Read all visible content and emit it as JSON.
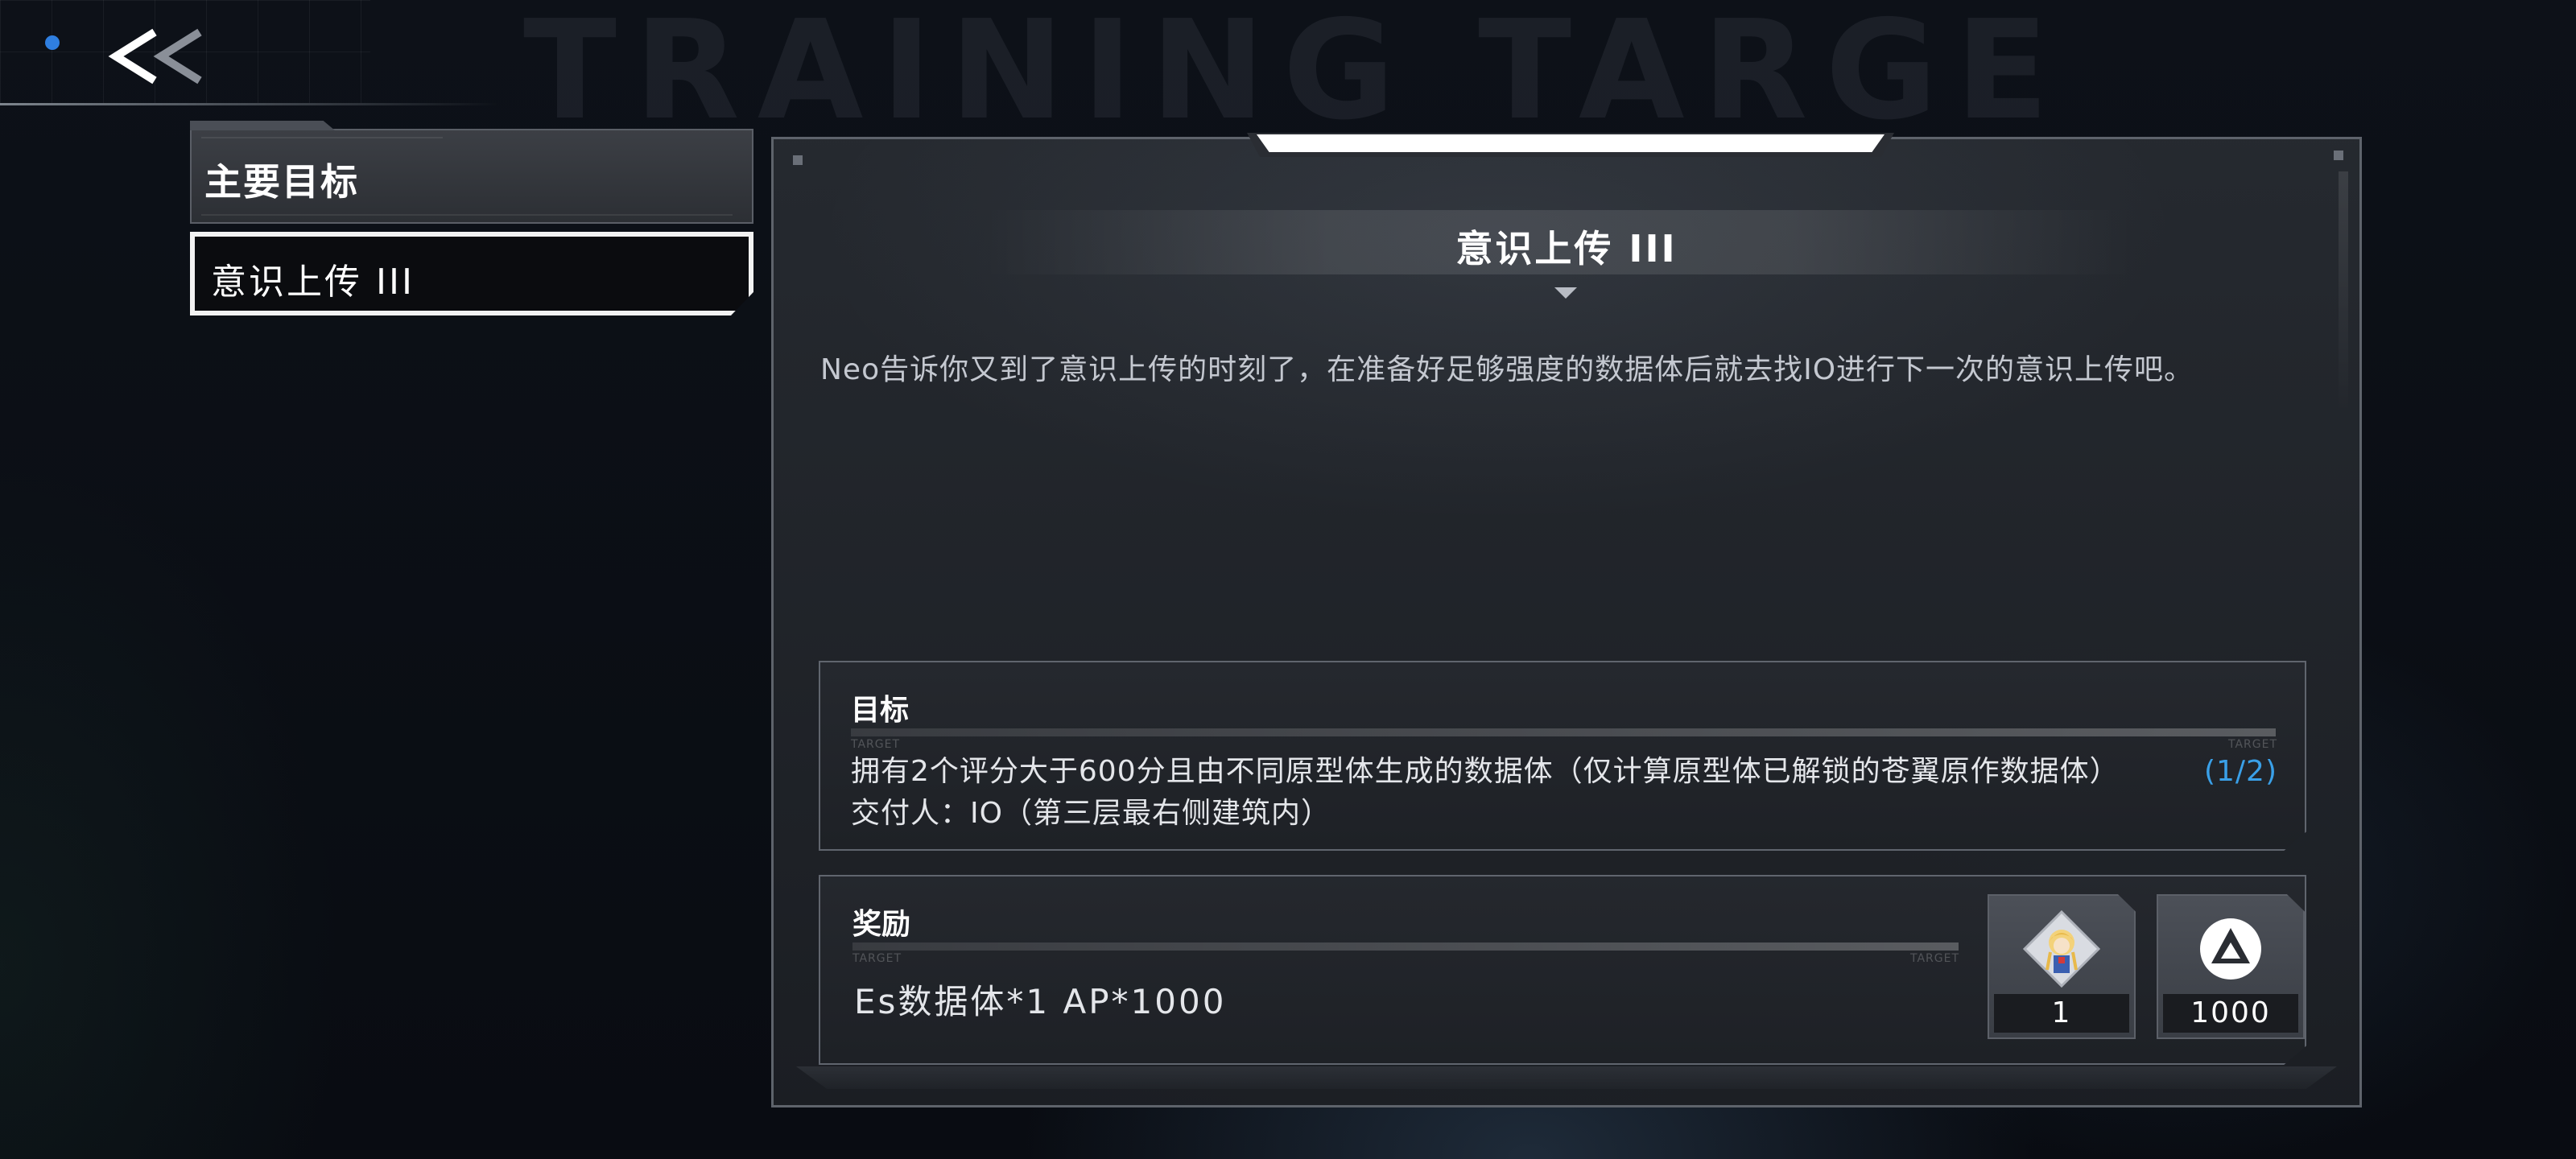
{
  "header": {
    "watermark": "TRAINING TARGET",
    "back_label": "back"
  },
  "sidebar": {
    "section_title": "主要目标",
    "items": [
      {
        "label": "意识上传 III",
        "selected": true
      }
    ]
  },
  "quest": {
    "title": "意识上传 III",
    "description": "Neo告诉你又到了意识上传的时刻了，在准备好足够强度的数据体后就去找IO进行下一次的意识上传吧。"
  },
  "objective": {
    "heading": "目标",
    "tag": "TARGET",
    "text": "拥有2个评分大于600分且由不同原型体生成的数据体（仅计算原型体已解锁的苍翼原作数据体）",
    "progress": "(1/2)",
    "deliver_to": "交付人：IO（第三层最右侧建筑内）"
  },
  "reward": {
    "heading": "奖励",
    "tag": "TARGET",
    "text": "Es数据体*1  AP*1000",
    "items": [
      {
        "icon": "character-portrait-icon",
        "count": "1"
      },
      {
        "icon": "ap-logo-icon",
        "count": "1000"
      }
    ]
  },
  "colors": {
    "accent_blue": "#3aa0e8",
    "status_dot": "#2f7fe0",
    "selected_border": "#f2f2f2"
  }
}
